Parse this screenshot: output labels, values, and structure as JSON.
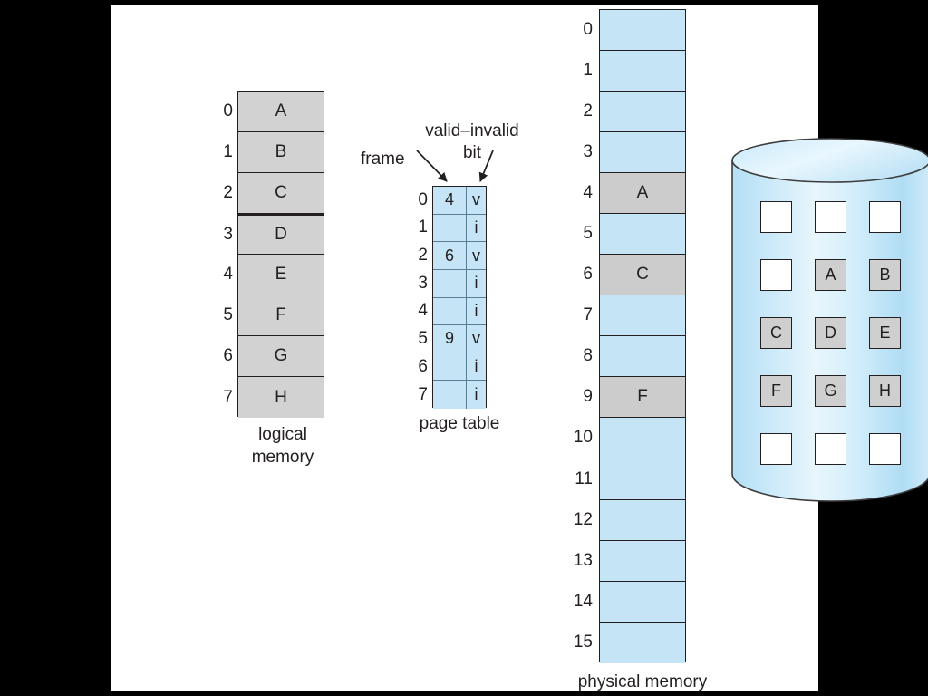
{
  "colors": {
    "page_fill": "#c5e5f7",
    "frame_fill": "#cccccc",
    "logical_fill": "#d2d2d2",
    "stroke": "#231f20",
    "canvas": "#ffffff",
    "backdrop": "#000000",
    "disk_empty": "#ffffff",
    "disk_used": "#cfcfcf"
  },
  "logical_memory": {
    "caption_line1": "logical",
    "caption_line2": "memory",
    "cells": [
      {
        "index": "0",
        "value": "A"
      },
      {
        "index": "1",
        "value": "B"
      },
      {
        "index": "2",
        "value": "C"
      },
      {
        "index": "3",
        "value": "D"
      },
      {
        "index": "4",
        "value": "E"
      },
      {
        "index": "5",
        "value": "F"
      },
      {
        "index": "6",
        "value": "G"
      },
      {
        "index": "7",
        "value": "H"
      }
    ]
  },
  "page_table": {
    "caption": "page table",
    "frame_label": "frame",
    "valid_invalid_label": "valid–invalid bit",
    "valid_invalid_line1": "valid–invalid",
    "valid_invalid_line2": "bit",
    "rows": [
      {
        "index": "0",
        "frame": "4",
        "bit": "v"
      },
      {
        "index": "1",
        "frame": "",
        "bit": "i"
      },
      {
        "index": "2",
        "frame": "6",
        "bit": "v"
      },
      {
        "index": "3",
        "frame": "",
        "bit": "i"
      },
      {
        "index": "4",
        "frame": "",
        "bit": "i"
      },
      {
        "index": "5",
        "frame": "9",
        "bit": "v"
      },
      {
        "index": "6",
        "frame": "",
        "bit": "i"
      },
      {
        "index": "7",
        "frame": "",
        "bit": "i"
      }
    ]
  },
  "physical_memory": {
    "caption": "physical memory",
    "cells": [
      {
        "index": "0",
        "value": "",
        "filled": false
      },
      {
        "index": "1",
        "value": "",
        "filled": false
      },
      {
        "index": "2",
        "value": "",
        "filled": false
      },
      {
        "index": "3",
        "value": "",
        "filled": false
      },
      {
        "index": "4",
        "value": "A",
        "filled": true
      },
      {
        "index": "5",
        "value": "",
        "filled": false
      },
      {
        "index": "6",
        "value": "C",
        "filled": true
      },
      {
        "index": "7",
        "value": "",
        "filled": false
      },
      {
        "index": "8",
        "value": "",
        "filled": false
      },
      {
        "index": "9",
        "value": "F",
        "filled": true
      },
      {
        "index": "10",
        "value": "",
        "filled": false
      },
      {
        "index": "11",
        "value": "",
        "filled": false
      },
      {
        "index": "12",
        "value": "",
        "filled": false
      },
      {
        "index": "13",
        "value": "",
        "filled": false
      },
      {
        "index": "14",
        "value": "",
        "filled": false
      },
      {
        "index": "15",
        "value": "",
        "filled": false
      }
    ]
  },
  "disk": {
    "blocks": [
      {
        "row": 0,
        "col": 0,
        "value": "",
        "used": false
      },
      {
        "row": 0,
        "col": 1,
        "value": "",
        "used": false
      },
      {
        "row": 0,
        "col": 2,
        "value": "",
        "used": false
      },
      {
        "row": 1,
        "col": 0,
        "value": "",
        "used": false
      },
      {
        "row": 1,
        "col": 1,
        "value": "A",
        "used": true
      },
      {
        "row": 1,
        "col": 2,
        "value": "B",
        "used": true
      },
      {
        "row": 2,
        "col": 0,
        "value": "C",
        "used": true
      },
      {
        "row": 2,
        "col": 1,
        "value": "D",
        "used": true
      },
      {
        "row": 2,
        "col": 2,
        "value": "E",
        "used": true
      },
      {
        "row": 3,
        "col": 0,
        "value": "F",
        "used": true
      },
      {
        "row": 3,
        "col": 1,
        "value": "G",
        "used": true
      },
      {
        "row": 3,
        "col": 2,
        "value": "H",
        "used": true
      },
      {
        "row": 4,
        "col": 0,
        "value": "",
        "used": false
      },
      {
        "row": 4,
        "col": 1,
        "value": "",
        "used": false
      },
      {
        "row": 4,
        "col": 2,
        "value": "",
        "used": false
      }
    ]
  }
}
